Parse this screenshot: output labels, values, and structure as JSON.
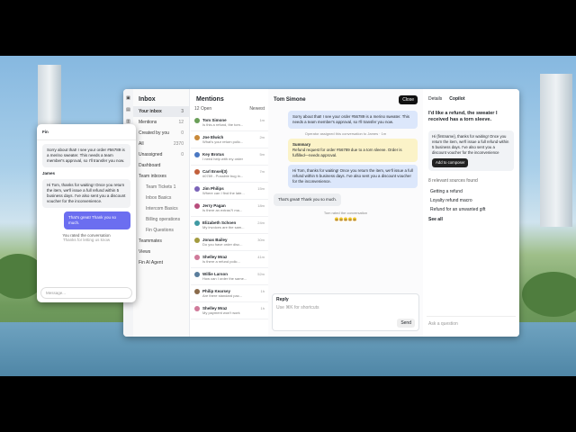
{
  "sidebar": {
    "title": "Inbox",
    "items": [
      {
        "label": "Your inbox",
        "count": "3"
      },
      {
        "label": "Mentions",
        "count": "12"
      },
      {
        "label": "Created by you",
        "count": "0"
      },
      {
        "label": "All",
        "count": "2370"
      },
      {
        "label": "Unassigned",
        "count": "0"
      },
      {
        "label": "Dashboard",
        "count": ""
      },
      {
        "label": "Team inboxes",
        "count": ""
      }
    ],
    "team": [
      "Team Tickets 1",
      "Inbox Basics",
      "Intercom Basics",
      "Billing operations",
      "Fin Questions"
    ],
    "sections": [
      "Teammates",
      "Views",
      "Fin AI Agent"
    ]
  },
  "list": {
    "title": "Mentions",
    "filter": "12 Open",
    "sort": "Newest",
    "items": [
      {
        "name": "Tom Simone",
        "preview": "Is this a refund, the tom...",
        "time": "1m",
        "color": "#6a9f58"
      },
      {
        "name": "Joe Elwich",
        "preview": "What's your return polic...",
        "time": "2m",
        "color": "#c98a3b"
      },
      {
        "name": "Key Brotus",
        "preview": "I need help with my order",
        "time": "5m",
        "color": "#4a78c2"
      },
      {
        "name": "Carl Ensel(3)",
        "preview": "#0789 - Possible bug in...",
        "time": "7m",
        "color": "#c2603c"
      },
      {
        "name": "Jim Philips",
        "preview": "Where can I find the late...",
        "time": "15m",
        "color": "#7b63b8"
      },
      {
        "name": "Jerry Pagan",
        "preview": "Is there an extras?I ma...",
        "time": "18m",
        "color": "#b84d7c"
      },
      {
        "name": "Elizabeth Schoen",
        "preview": "My invoices are the sam...",
        "time": "24m",
        "color": "#3f9aa3"
      },
      {
        "name": "Jonas Bailey",
        "preview": "Do you have order disc...",
        "time": "30m",
        "color": "#a39b3f"
      },
      {
        "name": "Shelley Mraz",
        "preview": "Is there a refund polic...",
        "time": "41m",
        "color": "#d07a9a"
      },
      {
        "name": "Willie Larson",
        "preview": "How can I order the same...",
        "time": "52m",
        "color": "#5a7d9c"
      },
      {
        "name": "Philip Kearsey",
        "preview": "Are there standard pac...",
        "time": "1h",
        "color": "#8a6a4a"
      },
      {
        "name": "Shelley Mraz",
        "preview": "My payment won't work",
        "time": "1h",
        "color": "#d07a9a"
      }
    ]
  },
  "conversation": {
    "title": "Tom Simone",
    "close_label": "Close",
    "messages": [
      {
        "type": "user",
        "text": "Sorry about that! I see your order #56789 is a merino sweater. This needs a team member's approval, so I'll transfer you now."
      },
      {
        "type": "note",
        "text": "Operator assigned this conversation to James · 1m"
      },
      {
        "type": "summary",
        "title": "Summary",
        "text": "Refund request for order #56789 due to a torn sleeve. Order is fulfilled—needs approval."
      },
      {
        "type": "agent",
        "text": "Hi Tom, thanks for waiting! Once you return the item, we'll issue a full refund within 5 business days. I've also sent you a discount voucher for the inconvenience."
      },
      {
        "type": "user2",
        "text": "That's great! Thank you so much."
      },
      {
        "type": "note",
        "text": "Tom rated the conversation"
      }
    ],
    "rating": "😀😀😀😀😀",
    "reply_label": "Reply",
    "reply_placeholder": "Use ⌘K for shortcuts",
    "send_label": "Send"
  },
  "copilot": {
    "tabs": [
      "Details",
      "Copilot"
    ],
    "question": "I'd like a refund, the sweater I received has a torn sleeve.",
    "answer": "Hi {firstname}, thanks for waiting! Once you return the item, we'll issue a full refund within 5 business days. I've also sent you a discount voucher for the inconvenience",
    "add_label": "Add to composer",
    "sources_label": "8 relevant sources found",
    "sources": [
      "Getting a refund",
      "Loyalty refund macro",
      "Refund for an unwanted gift"
    ],
    "see_all": "See all",
    "ask_placeholder": "Ask a question"
  },
  "widget": {
    "title": "Fin",
    "fin_msg": "Sorry about that! I see your order #56789 is a merino sweater. This needs a team member's approval, so I'll transfer you now.",
    "agent_name": "James",
    "agent_msg": "Hi Tom, thanks for waiting! Once you return the item, we'll issue a full refund within 5 business days. I've also sent you a discount voucher for the inconvenience.",
    "user_msg": "That's great! Thank you so much.",
    "rating_note": "You rated the conversation",
    "rating_thanks": "Thanks for letting us know",
    "input_placeholder": "Message..."
  }
}
